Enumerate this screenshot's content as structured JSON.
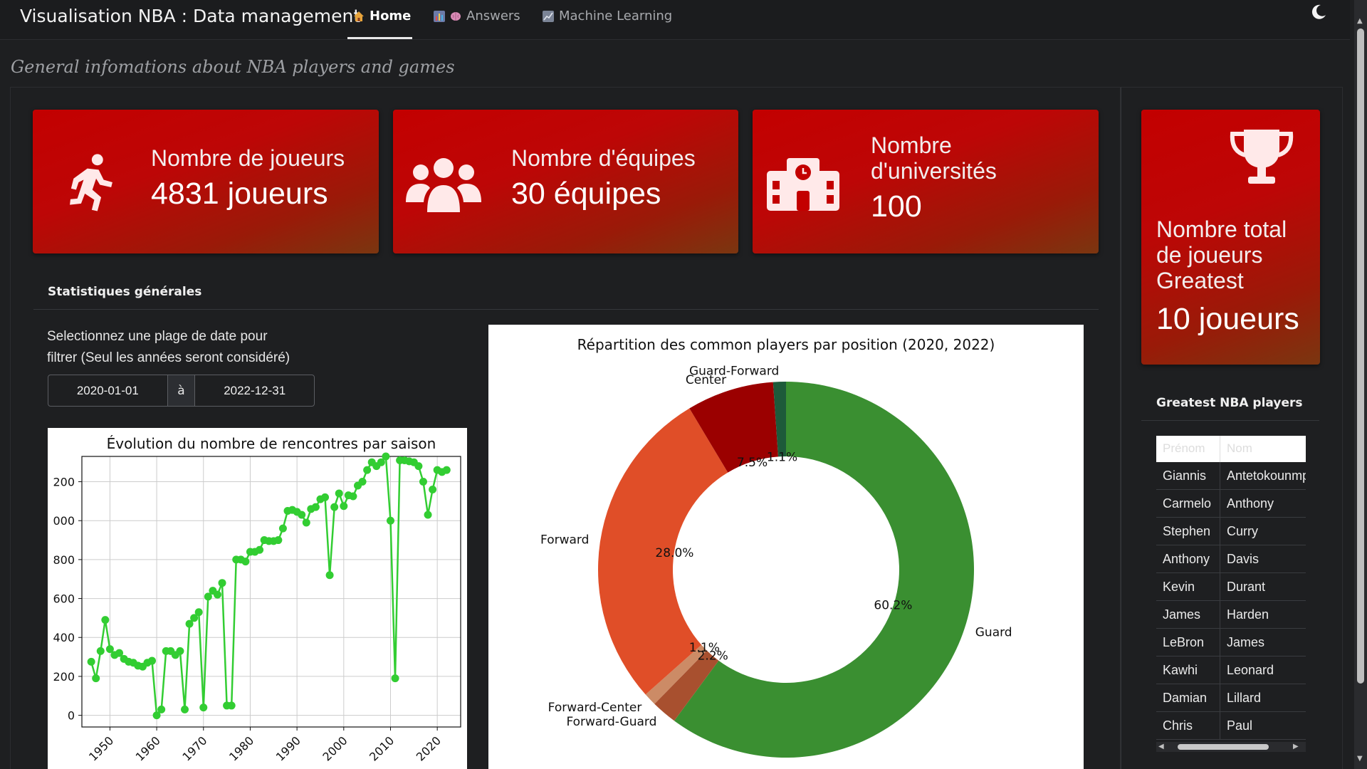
{
  "app": {
    "title": "Visualisation NBA : Data management"
  },
  "nav": [
    {
      "label": "Home",
      "icon": "house-icon",
      "active": true
    },
    {
      "label": "Answers",
      "icon": "chart-brain-icon",
      "active": false
    },
    {
      "label": "Machine Learning",
      "icon": "trend-chart-icon",
      "active": false
    }
  ],
  "subtitle": "General infomations about NBA players and games",
  "cards": {
    "players": {
      "label": "Nombre de joueurs",
      "value": "4831 joueurs"
    },
    "teams": {
      "label": "Nombre d'équipes",
      "value": "30 équipes"
    },
    "universities": {
      "label_line1": "Nombre",
      "label_line2": "d'universités",
      "value": "100"
    },
    "greatest": {
      "label_line1": "Nombre total",
      "label_line2": "de joueurs",
      "label_line3": "Greatest",
      "value": "10 joueurs"
    }
  },
  "section_title": "Statistiques générales",
  "filter": {
    "text_line1": "Selectionnez une plage de date pour",
    "text_line2": "filtrer (Seul les années seront considéré)",
    "start": "2020-01-01",
    "separator": "à",
    "end": "2022-12-31"
  },
  "greatest": {
    "title": "Greatest NBA players",
    "columns": [
      "Prénom",
      "Nom"
    ],
    "rows": [
      [
        "Giannis",
        "Antetokounmpo"
      ],
      [
        "Carmelo",
        "Anthony"
      ],
      [
        "Stephen",
        "Curry"
      ],
      [
        "Anthony",
        "Davis"
      ],
      [
        "Kevin",
        "Durant"
      ],
      [
        "James",
        "Harden"
      ],
      [
        "LeBron",
        "James"
      ],
      [
        "Kawhi",
        "Leonard"
      ],
      [
        "Damian",
        "Lillard"
      ],
      [
        "Chris",
        "Paul"
      ]
    ]
  },
  "colors": {
    "card_red": "#c30000",
    "line_green": "#32cd32",
    "guard": "#3a8f31",
    "forward": "#e04e28",
    "center": "#9b0000"
  },
  "chart_data": [
    {
      "type": "line",
      "title": "Évolution du nombre de rencontres par saison",
      "xlabel": "",
      "ylabel": "",
      "xticks": [
        "1950",
        "1960",
        "1970",
        "1980",
        "1990",
        "2000",
        "2010",
        "2020"
      ],
      "yticks": [
        "0",
        "200",
        "400",
        "600",
        "800",
        "000",
        "200"
      ],
      "xlim": [
        1944,
        2025
      ],
      "ylim": [
        -60,
        1330
      ],
      "grid": true,
      "x": [
        1946,
        1947,
        1948,
        1949,
        1950,
        1951,
        1952,
        1953,
        1954,
        1955,
        1956,
        1957,
        1958,
        1959,
        1960,
        1961,
        1962,
        1963,
        1964,
        1965,
        1966,
        1967,
        1968,
        1969,
        1970,
        1971,
        1972,
        1973,
        1974,
        1975,
        1976,
        1977,
        1978,
        1979,
        1980,
        1981,
        1982,
        1983,
        1984,
        1985,
        1986,
        1987,
        1988,
        1989,
        1990,
        1991,
        1992,
        1993,
        1994,
        1995,
        1996,
        1997,
        1998,
        1999,
        2000,
        2001,
        2002,
        2003,
        2004,
        2005,
        2006,
        2007,
        2008,
        2009,
        2010,
        2011,
        2012,
        2013,
        2014,
        2015,
        2016,
        2017,
        2018,
        2019,
        2020,
        2021,
        2022
      ],
      "y": [
        275,
        190,
        330,
        490,
        340,
        310,
        320,
        290,
        275,
        270,
        255,
        250,
        270,
        280,
        0,
        30,
        330,
        330,
        310,
        330,
        30,
        470,
        500,
        530,
        40,
        610,
        640,
        620,
        680,
        50,
        50,
        800,
        800,
        790,
        840,
        840,
        850,
        900,
        895,
        895,
        900,
        960,
        1050,
        1055,
        1045,
        1030,
        990,
        1060,
        1070,
        1110,
        1120,
        720,
        1070,
        1140,
        1075,
        1130,
        1125,
        1180,
        1200,
        1260,
        1300,
        1280,
        1300,
        1330,
        1000,
        190,
        1310,
        1310,
        1305,
        1300,
        1280,
        1200,
        1030,
        1160,
        1260,
        1250,
        1260
      ]
    },
    {
      "type": "pie",
      "donut": true,
      "title": "Répartition des common players par position (2020, 2022)",
      "slices": [
        {
          "label": "Guard",
          "value": 60.2,
          "pct": "60.2%"
        },
        {
          "label": "Forward-Guard",
          "value": 2.2,
          "pct": "2.2%"
        },
        {
          "label": "Forward-Center",
          "value": 1.1,
          "pct": "1.1%"
        },
        {
          "label": "Forward",
          "value": 28.0,
          "pct": "28.0%"
        },
        {
          "label": "Center",
          "value": 7.5,
          "pct": "7.5%"
        },
        {
          "label": "Guard-Forward",
          "value": 1.1,
          "pct": "1.1%"
        }
      ],
      "slice_colors": [
        "#3a8f31",
        "#a8502f",
        "#cc8b66",
        "#e04e28",
        "#9b0000",
        "#1d5a3a"
      ]
    }
  ]
}
